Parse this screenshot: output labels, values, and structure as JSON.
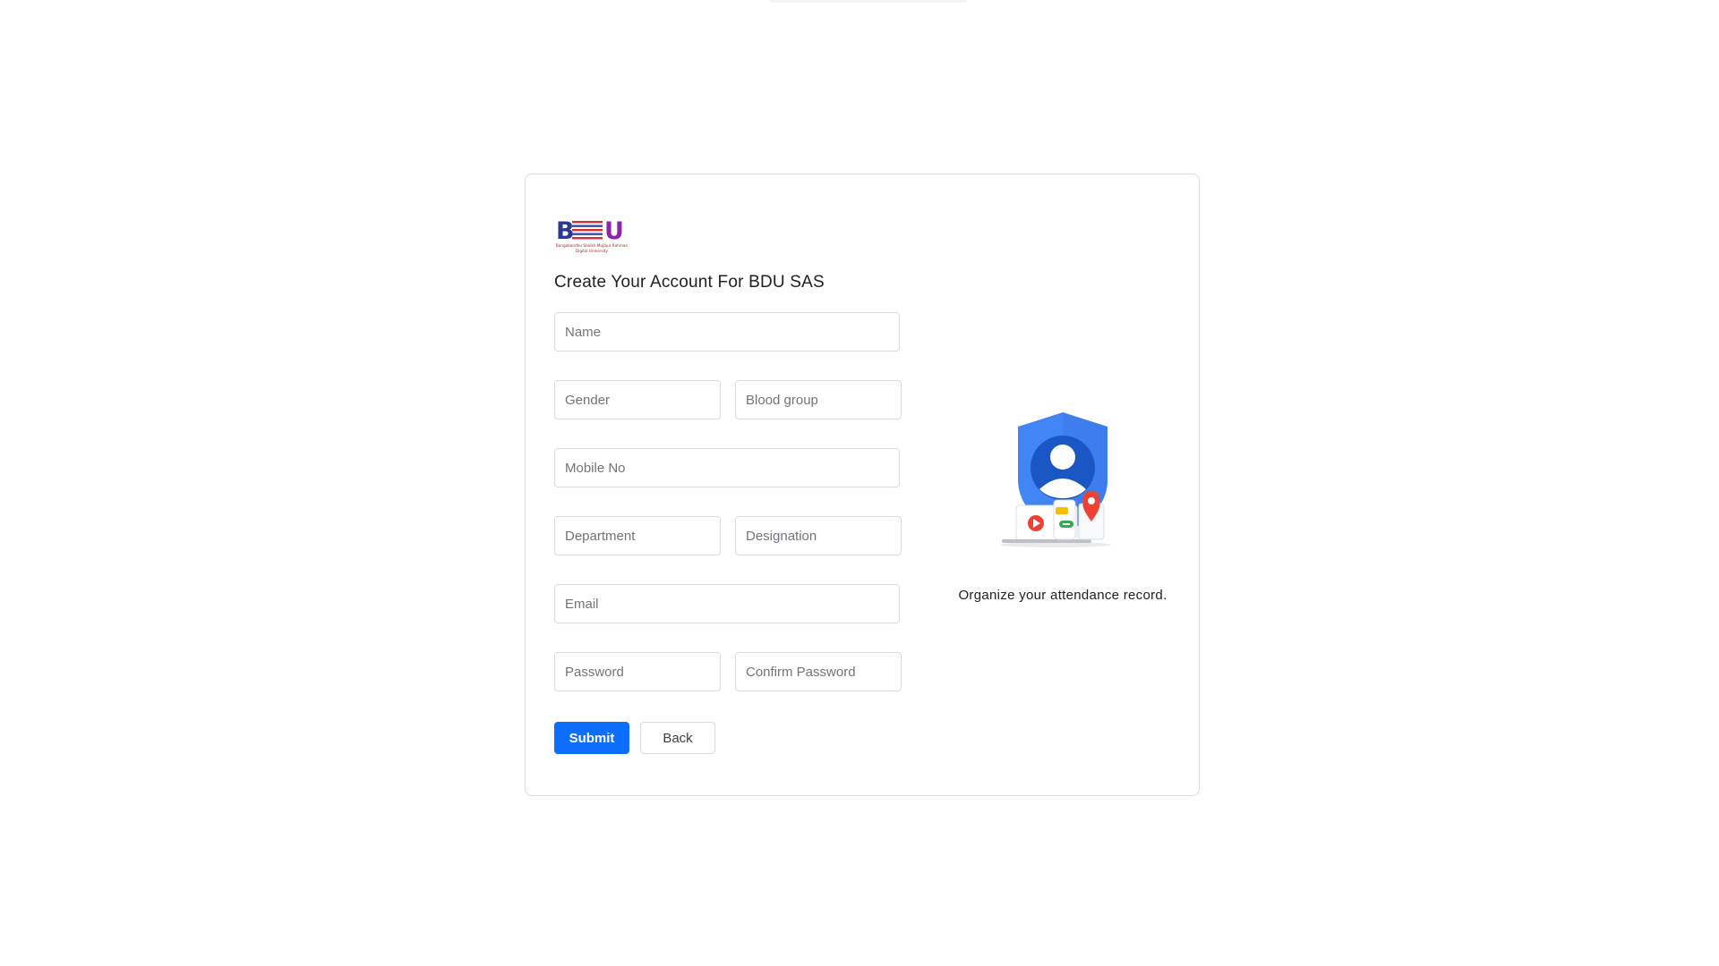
{
  "logo": {
    "text": "BDU",
    "subtitle": "Bangabandhu Sheikh Mujibur Rahman Digital University"
  },
  "form": {
    "title": "Create Your Account For BDU SAS",
    "name_placeholder": "Name",
    "gender_placeholder": "Gender",
    "blood_group_placeholder": "Blood group",
    "mobile_placeholder": "Mobile No",
    "department_placeholder": "Department",
    "designation_placeholder": "Designation",
    "email_placeholder": "Email",
    "password_placeholder": "Password",
    "confirm_password_placeholder": "Confirm Password",
    "submit_label": "Submit",
    "back_label": "Back"
  },
  "aside": {
    "caption": "Organize your attendance record."
  },
  "colors": {
    "primary": "#0d6efd",
    "border": "#dadce0",
    "shield": "#4285f4"
  }
}
